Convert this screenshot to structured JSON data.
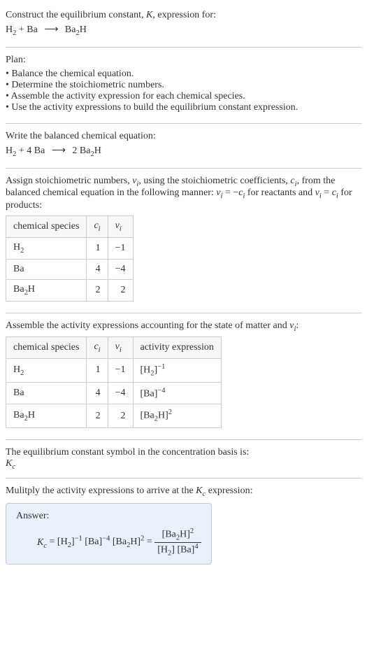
{
  "title": "Construct the equilibrium constant, K, expression for:",
  "eq1": "H₂ + Ba ⟶ Ba₂H",
  "plan_label": "Plan:",
  "plan": [
    "Balance the chemical equation.",
    "Determine the stoichiometric numbers.",
    "Assemble the activity expression for each chemical species.",
    "Use the activity expressions to build the equilibrium constant expression."
  ],
  "balanced_label": "Write the balanced chemical equation:",
  "eq2": "H₂ + 4 Ba ⟶ 2 Ba₂H",
  "assign_text": "Assign stoichiometric numbers, νᵢ, using the stoichiometric coefficients, cᵢ, from the balanced chemical equation in the following manner: νᵢ = −cᵢ for reactants and νᵢ = cᵢ for products:",
  "table1": {
    "headers": [
      "chemical species",
      "cᵢ",
      "νᵢ"
    ],
    "rows": [
      [
        "H₂",
        "1",
        "−1"
      ],
      [
        "Ba",
        "4",
        "−4"
      ],
      [
        "Ba₂H",
        "2",
        "2"
      ]
    ]
  },
  "assemble_text": "Assemble the activity expressions accounting for the state of matter and νᵢ:",
  "table2": {
    "headers": [
      "chemical species",
      "cᵢ",
      "νᵢ",
      "activity expression"
    ],
    "rows": [
      [
        "H₂",
        "1",
        "−1",
        "[H₂]⁻¹"
      ],
      [
        "Ba",
        "4",
        "−4",
        "[Ba]⁻⁴"
      ],
      [
        "Ba₂H",
        "2",
        "2",
        "[Ba₂H]²"
      ]
    ]
  },
  "symbol_text": "The equilibrium constant symbol in the concentration basis is:",
  "kc": "K꜀",
  "multiply_text": "Mulitply the activity expressions to arrive at the K꜀ expression:",
  "answer_label": "Answer:",
  "answer_lhs": "K꜀ = [H₂]⁻¹ [Ba]⁻⁴ [Ba₂H]² = ",
  "answer_num": "[Ba₂H]²",
  "answer_den": "[H₂] [Ba]⁴"
}
